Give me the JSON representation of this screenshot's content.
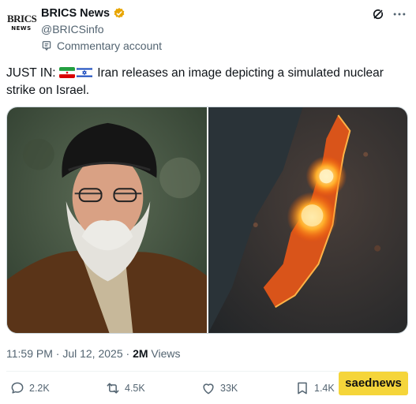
{
  "author": {
    "logo_text_top": "BRICS",
    "logo_text_bottom": "NEWS",
    "name": "BRICS News",
    "handle": "@BRICSinfo",
    "label": "Commentary account"
  },
  "post": {
    "prefix": "JUST IN:",
    "text": "Iran releases an image depicting a simulated nuclear strike on Israel.",
    "flags": [
      "iran-flag",
      "israel-flag"
    ],
    "timestamp": "11:59 PM · Jul 12, 2025 · ",
    "views_count": "2M",
    "views_label": " Views"
  },
  "actions": {
    "replies": "2.2K",
    "reposts": "4.5K",
    "likes": "33K",
    "bookmarks": "1.4K"
  },
  "watermark": "saednews",
  "colors": {
    "secondary_text": "#536471",
    "verified": "#e8a500",
    "watermark_bg": "#f5d53a"
  }
}
